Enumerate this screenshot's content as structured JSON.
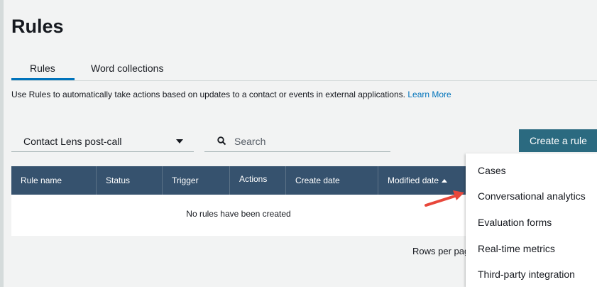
{
  "page": {
    "title": "Rules"
  },
  "tabs": [
    {
      "label": "Rules",
      "active": true
    },
    {
      "label": "Word collections",
      "active": false
    }
  ],
  "description": {
    "text": "Use Rules to automatically take actions based on updates to a contact or events in external applications.",
    "link": "Learn More"
  },
  "filter": {
    "selected": "Contact Lens post-call"
  },
  "search": {
    "placeholder": "Search",
    "value": ""
  },
  "create_button": {
    "label": "Create a rule"
  },
  "table": {
    "columns": [
      "Rule name",
      "Status",
      "Trigger",
      "Actions",
      "Create date",
      "Modified date"
    ],
    "sorted_column": "Modified date",
    "sort_direction": "ascending",
    "empty_message": "No rules have been created"
  },
  "pagination": {
    "rows_per_page_label": "Rows per page"
  },
  "create_menu": {
    "items": [
      "Cases",
      "Conversational analytics",
      "Evaluation forms",
      "Real-time metrics",
      "Third-party integration"
    ]
  },
  "colors": {
    "accent": "#0073bb",
    "button": "#2b6a80",
    "table_header": "#36526e",
    "annotation_arrow": "#e8473b"
  }
}
